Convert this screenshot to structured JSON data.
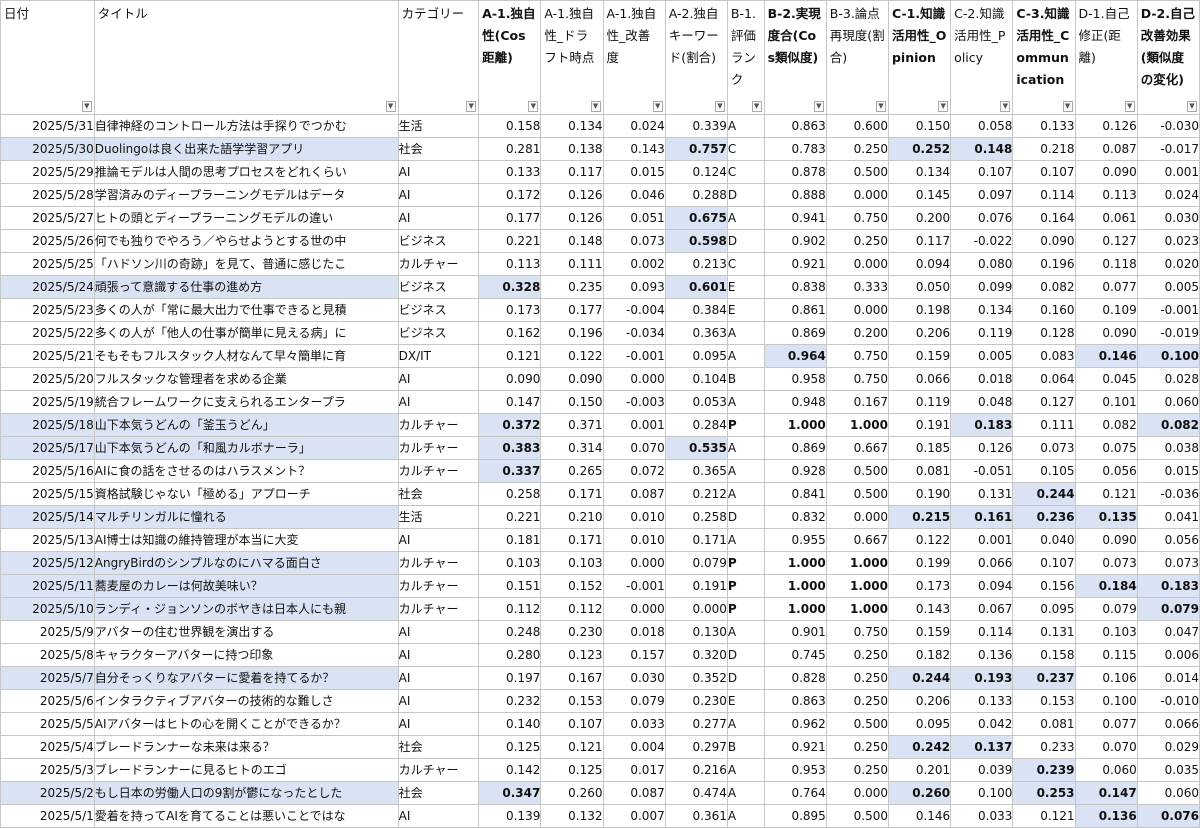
{
  "sheet": {
    "filter_icon": "dropdown-arrow-icon",
    "highlight_color": "#dae3f3",
    "grid_color": "#c6c6c6"
  },
  "columns": [
    {
      "label": "日付",
      "bold": false
    },
    {
      "label": "タイトル",
      "bold": false
    },
    {
      "label": "カテゴリー",
      "bold": false
    },
    {
      "label": "A-1.独自性(Cos距離)",
      "bold": true
    },
    {
      "label": "A-1.独自性_ドラフト時点",
      "bold": false
    },
    {
      "label": "A-1.独自性_改善度",
      "bold": false
    },
    {
      "label": "A-2.独自キーワード(割合)",
      "bold": false
    },
    {
      "label": "B-1.評価ランク",
      "bold": false
    },
    {
      "label": "B-2.実現度合(Cos類似度)",
      "bold": true
    },
    {
      "label": "B-3.論点再現度(割合)",
      "bold": false
    },
    {
      "label": "C-1.知識活用性_Opinion",
      "bold": true
    },
    {
      "label": "C-2.知識活用性_Policy",
      "bold": false
    },
    {
      "label": "C-3.知識活用性_Communication",
      "bold": true
    },
    {
      "label": "D-1.自己修正(距離)",
      "bold": false
    },
    {
      "label": "D-2.自己改善効果(類似度の変化)",
      "bold": true
    }
  ],
  "rows": [
    {
      "rowhl": false,
      "cells": [
        "2025/5/31",
        "自律神経のコントロール方法は手探りでつかむ",
        "生活",
        "0.158",
        "0.134",
        "0.024",
        "0.339",
        "A",
        "0.863",
        "0.600",
        "0.150",
        "0.058",
        "0.133",
        "0.126",
        "-0.030"
      ],
      "hl": [],
      "b": []
    },
    {
      "rowhl": true,
      "cells": [
        "2025/5/30",
        "Duolingoは良く出来た語学学習アプリ",
        "社会",
        "0.281",
        "0.138",
        "0.143",
        "0.757",
        "C",
        "0.783",
        "0.250",
        "0.252",
        "0.148",
        "0.218",
        "0.087",
        "-0.017"
      ],
      "hl": [
        6,
        10,
        11
      ],
      "b": [
        6,
        10,
        11
      ]
    },
    {
      "rowhl": false,
      "cells": [
        "2025/5/29",
        "推論モデルは人間の思考プロセスをどれくらい",
        "AI",
        "0.133",
        "0.117",
        "0.015",
        "0.124",
        "C",
        "0.878",
        "0.500",
        "0.134",
        "0.107",
        "0.107",
        "0.090",
        "0.001"
      ],
      "hl": [],
      "b": []
    },
    {
      "rowhl": false,
      "cells": [
        "2025/5/28",
        "学習済みのディープラーニングモデルはデータ",
        "AI",
        "0.172",
        "0.126",
        "0.046",
        "0.288",
        "D",
        "0.888",
        "0.000",
        "0.145",
        "0.097",
        "0.114",
        "0.113",
        "0.024"
      ],
      "hl": [],
      "b": []
    },
    {
      "rowhl": false,
      "cells": [
        "2025/5/27",
        "ヒトの頭とディープラーニングモデルの違い",
        "AI",
        "0.177",
        "0.126",
        "0.051",
        "0.675",
        "A",
        "0.941",
        "0.750",
        "0.200",
        "0.076",
        "0.164",
        "0.061",
        "0.030"
      ],
      "hl": [
        6
      ],
      "b": [
        6
      ]
    },
    {
      "rowhl": false,
      "cells": [
        "2025/5/26",
        "何でも独りでやろう／やらせようとする世の中",
        "ビジネス",
        "0.221",
        "0.148",
        "0.073",
        "0.598",
        "D",
        "0.902",
        "0.250",
        "0.117",
        "-0.022",
        "0.090",
        "0.127",
        "0.023"
      ],
      "hl": [
        6
      ],
      "b": [
        6
      ]
    },
    {
      "rowhl": false,
      "cells": [
        "2025/5/25",
        "「ハドソン川の奇跡」を見て、普通に感じたこ",
        "カルチャー",
        "0.113",
        "0.111",
        "0.002",
        "0.213",
        "C",
        "0.921",
        "0.000",
        "0.094",
        "0.080",
        "0.196",
        "0.118",
        "0.020"
      ],
      "hl": [],
      "b": []
    },
    {
      "rowhl": true,
      "cells": [
        "2025/5/24",
        "頑張って意識する仕事の進め方",
        "ビジネス",
        "0.328",
        "0.235",
        "0.093",
        "0.601",
        "E",
        "0.838",
        "0.333",
        "0.050",
        "0.099",
        "0.082",
        "0.077",
        "0.005"
      ],
      "hl": [
        3,
        6
      ],
      "b": [
        3,
        6
      ]
    },
    {
      "rowhl": false,
      "cells": [
        "2025/5/23",
        "多くの人が「常に最大出力で仕事できると見積",
        "ビジネス",
        "0.173",
        "0.177",
        "-0.004",
        "0.384",
        "E",
        "0.861",
        "0.000",
        "0.198",
        "0.134",
        "0.160",
        "0.109",
        "-0.001"
      ],
      "hl": [],
      "b": []
    },
    {
      "rowhl": false,
      "cells": [
        "2025/5/22",
        "多くの人が「他人の仕事が簡単に見える病」に",
        "ビジネス",
        "0.162",
        "0.196",
        "-0.034",
        "0.363",
        "A",
        "0.869",
        "0.200",
        "0.206",
        "0.119",
        "0.128",
        "0.090",
        "-0.019"
      ],
      "hl": [],
      "b": []
    },
    {
      "rowhl": false,
      "cells": [
        "2025/5/21",
        "そもそもフルスタック人材なんて早々簡単に育",
        "DX/IT",
        "0.121",
        "0.122",
        "-0.001",
        "0.095",
        "A",
        "0.964",
        "0.750",
        "0.159",
        "0.005",
        "0.083",
        "0.146",
        "0.100"
      ],
      "hl": [
        8,
        13,
        14
      ],
      "b": [
        8,
        13,
        14
      ]
    },
    {
      "rowhl": false,
      "cells": [
        "2025/5/20",
        "フルスタックな管理者を求める企業",
        "AI",
        "0.090",
        "0.090",
        "0.000",
        "0.104",
        "B",
        "0.958",
        "0.750",
        "0.066",
        "0.018",
        "0.064",
        "0.045",
        "0.028"
      ],
      "hl": [],
      "b": []
    },
    {
      "rowhl": false,
      "cells": [
        "2025/5/19",
        "統合フレームワークに支えられるエンタープラ",
        "AI",
        "0.147",
        "0.150",
        "-0.003",
        "0.053",
        "A",
        "0.948",
        "0.167",
        "0.119",
        "0.048",
        "0.127",
        "0.101",
        "0.060"
      ],
      "hl": [],
      "b": []
    },
    {
      "rowhl": true,
      "cells": [
        "2025/5/18",
        "山下本気うどんの「釜玉うどん」",
        "カルチャー",
        "0.372",
        "0.371",
        "0.001",
        "0.284",
        "P",
        "1.000",
        "1.000",
        "0.191",
        "0.183",
        "0.111",
        "0.082",
        "0.082"
      ],
      "hl": [
        3,
        11,
        14
      ],
      "b": [
        3,
        7,
        8,
        9,
        11,
        14
      ]
    },
    {
      "rowhl": true,
      "cells": [
        "2025/5/17",
        "山下本気うどんの「和風カルボナーラ」",
        "カルチャー",
        "0.383",
        "0.314",
        "0.070",
        "0.535",
        "A",
        "0.869",
        "0.667",
        "0.185",
        "0.126",
        "0.073",
        "0.075",
        "0.038"
      ],
      "hl": [
        3,
        6
      ],
      "b": [
        3,
        6
      ]
    },
    {
      "rowhl": false,
      "cells": [
        "2025/5/16",
        "AIに食の話をさせるのはハラスメント？",
        "カルチャー",
        "0.337",
        "0.265",
        "0.072",
        "0.365",
        "A",
        "0.928",
        "0.500",
        "0.081",
        "-0.051",
        "0.105",
        "0.056",
        "0.015"
      ],
      "hl": [
        3
      ],
      "b": [
        3
      ]
    },
    {
      "rowhl": false,
      "cells": [
        "2025/5/15",
        "資格試験じゃない「極める」アプローチ",
        "社会",
        "0.258",
        "0.171",
        "0.087",
        "0.212",
        "A",
        "0.841",
        "0.500",
        "0.190",
        "0.131",
        "0.244",
        "0.121",
        "-0.036"
      ],
      "hl": [
        12
      ],
      "b": [
        12
      ]
    },
    {
      "rowhl": true,
      "cells": [
        "2025/5/14",
        "マルチリンガルに憧れる",
        "生活",
        "0.221",
        "0.210",
        "0.010",
        "0.258",
        "D",
        "0.832",
        "0.000",
        "0.215",
        "0.161",
        "0.236",
        "0.135",
        "0.041"
      ],
      "hl": [
        10,
        11,
        12,
        13
      ],
      "b": [
        10,
        11,
        12,
        13
      ]
    },
    {
      "rowhl": false,
      "cells": [
        "2025/5/13",
        "AI博士は知識の維持管理が本当に大変",
        "AI",
        "0.181",
        "0.171",
        "0.010",
        "0.171",
        "A",
        "0.955",
        "0.667",
        "0.122",
        "0.001",
        "0.040",
        "0.090",
        "0.056"
      ],
      "hl": [],
      "b": []
    },
    {
      "rowhl": true,
      "cells": [
        "2025/5/12",
        "AngryBirdのシンプルなのにハマる面白さ",
        "カルチャー",
        "0.103",
        "0.103",
        "0.000",
        "0.079",
        "P",
        "1.000",
        "1.000",
        "0.199",
        "0.066",
        "0.107",
        "0.073",
        "0.073"
      ],
      "hl": [],
      "b": [
        7,
        8,
        9
      ]
    },
    {
      "rowhl": true,
      "cells": [
        "2025/5/11",
        "蕎麦屋のカレーは何故美味い？",
        "カルチャー",
        "0.151",
        "0.152",
        "-0.001",
        "0.191",
        "P",
        "1.000",
        "1.000",
        "0.173",
        "0.094",
        "0.156",
        "0.184",
        "0.183"
      ],
      "hl": [
        13,
        14
      ],
      "b": [
        7,
        8,
        9,
        13,
        14
      ]
    },
    {
      "rowhl": true,
      "cells": [
        "2025/5/10",
        "ランディ・ジョンソンのボヤきは日本人にも親",
        "カルチャー",
        "0.112",
        "0.112",
        "0.000",
        "0.000",
        "P",
        "1.000",
        "1.000",
        "0.143",
        "0.067",
        "0.095",
        "0.079",
        "0.079"
      ],
      "hl": [
        14
      ],
      "b": [
        7,
        8,
        9,
        14
      ]
    },
    {
      "rowhl": false,
      "cells": [
        "2025/5/9",
        "アバターの住む世界観を演出する",
        "AI",
        "0.248",
        "0.230",
        "0.018",
        "0.130",
        "A",
        "0.901",
        "0.750",
        "0.159",
        "0.114",
        "0.131",
        "0.103",
        "0.047"
      ],
      "hl": [],
      "b": []
    },
    {
      "rowhl": false,
      "cells": [
        "2025/5/8",
        "キャラクターアバターに持つ印象",
        "AI",
        "0.280",
        "0.123",
        "0.157",
        "0.320",
        "D",
        "0.745",
        "0.250",
        "0.182",
        "0.136",
        "0.158",
        "0.115",
        "0.006"
      ],
      "hl": [],
      "b": []
    },
    {
      "rowhl": true,
      "cells": [
        "2025/5/7",
        "自分そっくりなアバターに愛着を持てるか？",
        "AI",
        "0.197",
        "0.167",
        "0.030",
        "0.352",
        "D",
        "0.828",
        "0.250",
        "0.244",
        "0.193",
        "0.237",
        "0.106",
        "0.014"
      ],
      "hl": [
        10,
        11,
        12
      ],
      "b": [
        10,
        11,
        12
      ]
    },
    {
      "rowhl": false,
      "cells": [
        "2025/5/6",
        "インタラクティブアバターの技術的な難しさ",
        "AI",
        "0.232",
        "0.153",
        "0.079",
        "0.230",
        "E",
        "0.863",
        "0.250",
        "0.206",
        "0.133",
        "0.153",
        "0.100",
        "-0.010"
      ],
      "hl": [],
      "b": []
    },
    {
      "rowhl": false,
      "cells": [
        "2025/5/5",
        "AIアバターはヒトの心を開くことができるか？",
        "AI",
        "0.140",
        "0.107",
        "0.033",
        "0.277",
        "A",
        "0.962",
        "0.500",
        "0.095",
        "0.042",
        "0.081",
        "0.077",
        "0.066"
      ],
      "hl": [],
      "b": []
    },
    {
      "rowhl": false,
      "cells": [
        "2025/5/4",
        "ブレードランナーな未来は来る？",
        "社会",
        "0.125",
        "0.121",
        "0.004",
        "0.297",
        "B",
        "0.921",
        "0.250",
        "0.242",
        "0.137",
        "0.233",
        "0.070",
        "0.029"
      ],
      "hl": [
        10,
        11
      ],
      "b": [
        10,
        11
      ]
    },
    {
      "rowhl": false,
      "cells": [
        "2025/5/3",
        "ブレードランナーに見るヒトのエゴ",
        "カルチャー",
        "0.142",
        "0.125",
        "0.017",
        "0.216",
        "A",
        "0.953",
        "0.250",
        "0.201",
        "0.039",
        "0.239",
        "0.060",
        "0.035"
      ],
      "hl": [
        12
      ],
      "b": [
        12
      ]
    },
    {
      "rowhl": true,
      "cells": [
        "2025/5/2",
        "もし日本の労働人口の9割が鬱になったとした",
        "社会",
        "0.347",
        "0.260",
        "0.087",
        "0.474",
        "A",
        "0.764",
        "0.000",
        "0.260",
        "0.100",
        "0.253",
        "0.147",
        "0.060"
      ],
      "hl": [
        3,
        10,
        12,
        13
      ],
      "b": [
        3,
        10,
        12,
        13
      ]
    },
    {
      "rowhl": false,
      "cells": [
        "2025/5/1",
        "愛着を持ってAIを育てることは悪いことではな",
        "AI",
        "0.139",
        "0.132",
        "0.007",
        "0.361",
        "A",
        "0.895",
        "0.500",
        "0.146",
        "0.033",
        "0.121",
        "0.136",
        "0.076"
      ],
      "hl": [
        13,
        14
      ],
      "b": [
        13,
        14
      ]
    }
  ]
}
